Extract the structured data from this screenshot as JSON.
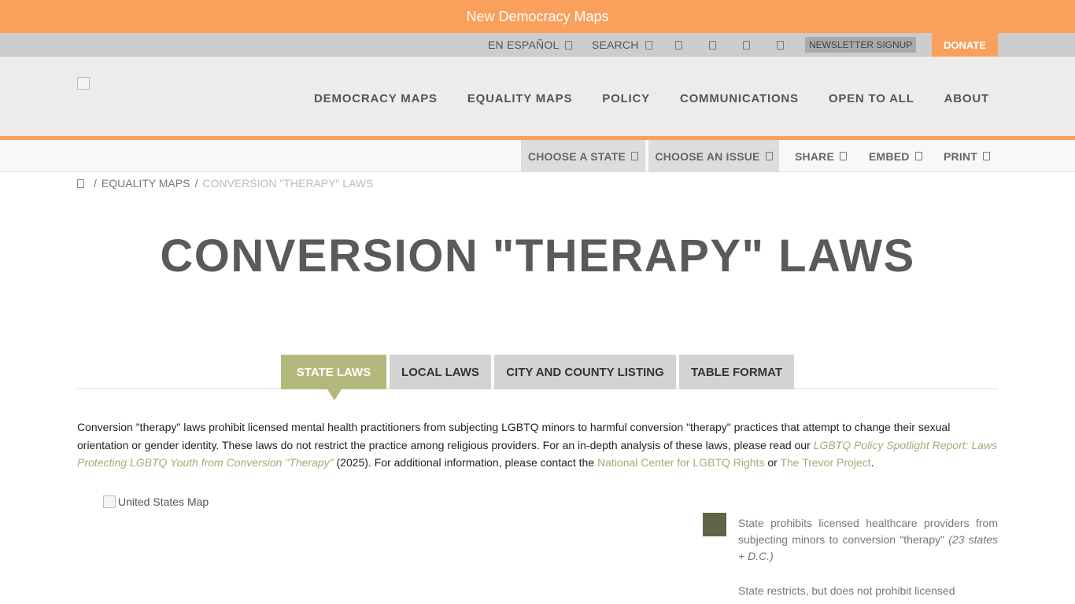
{
  "banner": {
    "text": "New Democracy Maps"
  },
  "utility": {
    "espanol": "EN ESPAÑOL",
    "search": "SEARCH",
    "newsletter": "NEWSLETTER SIGNUP",
    "donate": "DONATE"
  },
  "nav": {
    "items": [
      "DEMOCRACY MAPS",
      "EQUALITY MAPS",
      "POLICY",
      "COMMUNICATIONS",
      "OPEN TO ALL",
      "ABOUT"
    ]
  },
  "subnav": {
    "choose_state": "CHOOSE A STATE",
    "choose_issue": "CHOOSE AN ISSUE",
    "share": "SHARE",
    "embed": "EMBED",
    "print": "PRINT"
  },
  "breadcrumb": {
    "parent": "EQUALITY MAPS",
    "current": "CONVERSION \"THERAPY\" LAWS",
    "separator": "/"
  },
  "page": {
    "title": "CONVERSION \"THERAPY\" LAWS"
  },
  "tabs": [
    "STATE LAWS",
    "LOCAL LAWS",
    "CITY AND COUNTY LISTING",
    "TABLE FORMAT"
  ],
  "intro": {
    "text1": "Conversion \"therapy\" laws prohibit licensed mental health practitioners from subjecting LGBTQ minors to harmful conversion \"therapy\" practices that attempt to change their sexual orientation or gender identity. These laws do not restrict the practice among religious providers. For an in-depth analysis of these laws, please read our ",
    "link_report": "LGBTQ Policy Spotlight Report: Laws Protecting LGBTQ Youth from Conversion \"Therapy\"",
    "text2": " (2025). For additional information, please contact the ",
    "link_nclr": "National Center for LGBTQ Rights",
    "text3": " or ",
    "link_trevor": "The Trevor Project",
    "text4": "."
  },
  "map": {
    "alt": "United States Map"
  },
  "legend": {
    "items": [
      {
        "text": "State prohibits licensed healthcare providers from subjecting minors to conversion \"therapy\"",
        "count": "(23 states + D.C.)",
        "color": "#5e6545"
      },
      {
        "text": "State restricts, but does not prohibit licensed"
      }
    ]
  },
  "colors": {
    "accent": "#f9a05c",
    "tab_active": "#b4b87d",
    "link": "#a6ab73"
  }
}
